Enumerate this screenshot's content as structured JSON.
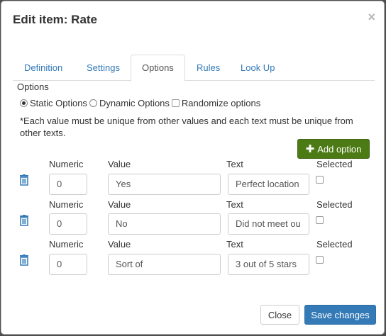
{
  "modal": {
    "title": "Edit item: Rate",
    "close_glyph": "×"
  },
  "tabs": [
    {
      "label": "Definition",
      "active": false
    },
    {
      "label": "Settings",
      "active": false
    },
    {
      "label": "Options",
      "active": true
    },
    {
      "label": "Rules",
      "active": false
    },
    {
      "label": "Look Up",
      "active": false
    }
  ],
  "options": {
    "section_label": "Options",
    "static_label": "Static Options",
    "dynamic_label": "Dynamic Options",
    "randomize_label": "Randomize options",
    "selected_mode": "static",
    "randomize_checked": false,
    "note": "*Each value must be unique from other values and each text must be unique from other texts.",
    "add_label": "Add option"
  },
  "columns": {
    "numeric": "Numeric",
    "value": "Value",
    "text": "Text",
    "selected": "Selected"
  },
  "rows": [
    {
      "numeric": "0",
      "value": "Yes",
      "text": "Perfect location",
      "selected": false
    },
    {
      "numeric": "0",
      "value": "No",
      "text": "Did not meet ou",
      "selected": false
    },
    {
      "numeric": "0",
      "value": "Sort of",
      "text": "3 out of 5 stars",
      "selected": false
    }
  ],
  "footer": {
    "close_label": "Close",
    "save_label": "Save changes"
  },
  "colors": {
    "primary": "#337ab7",
    "success": "#4c7a14",
    "link": "#337ab7"
  }
}
